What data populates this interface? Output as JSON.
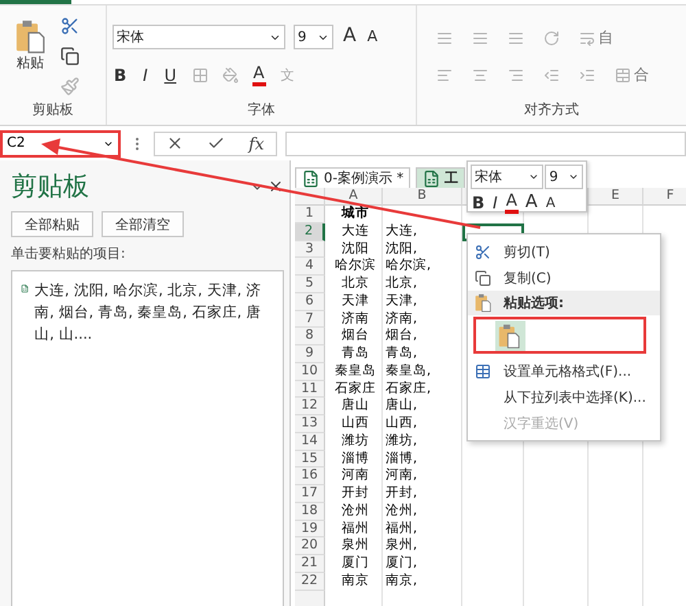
{
  "ribbon": {
    "clipboard": {
      "paste_label": "粘贴",
      "group_label": "剪贴板"
    },
    "font": {
      "name": "宋体",
      "size": "9",
      "grow": "A",
      "shrink": "A",
      "bold": "B",
      "italic": "I",
      "underline": "U",
      "font_color": "A",
      "phonetic": "文",
      "group_label": "字体"
    },
    "alignment": {
      "wrap_label": "自",
      "merge_label": "合",
      "group_label": "对齐方式"
    }
  },
  "formula_bar": {
    "name_box": "C2",
    "highlighted": true,
    "fx": "fx"
  },
  "clipboard_pane": {
    "title": "剪贴板",
    "buttons": [
      "全部粘贴",
      "全部清空"
    ],
    "prompt": "单击要粘贴的项目:",
    "items": [
      {
        "text": "大连, 沈阳, 哈尔滨, 北京, 天津, 济南, 烟台, 青岛, 秦皇岛, 石家庄, 唐山, 山...."
      }
    ]
  },
  "sheet": {
    "tabs": [
      {
        "label": "0-案例演示 *",
        "selected": false
      },
      {
        "label": "工",
        "selected": true
      }
    ],
    "column_headers": [
      "A",
      "B",
      "E",
      "F"
    ],
    "rows": [
      {
        "n": "1",
        "a": "城市",
        "selected": false
      },
      {
        "n": "2",
        "a": "大连",
        "b": "大连,",
        "selected": true
      },
      {
        "n": "3",
        "a": "沈阳",
        "b": "沈阳,",
        "selected": false
      },
      {
        "n": "4",
        "a": "哈尔滨",
        "b": "哈尔滨,",
        "selected": false
      },
      {
        "n": "5",
        "a": "北京",
        "b": "北京,",
        "selected": false
      },
      {
        "n": "6",
        "a": "天津",
        "b": "天津,",
        "selected": false
      },
      {
        "n": "7",
        "a": "济南",
        "b": "济南,",
        "selected": false
      },
      {
        "n": "8",
        "a": "烟台",
        "b": "烟台,",
        "selected": false
      },
      {
        "n": "9",
        "a": "青岛",
        "b": "青岛,",
        "selected": false
      },
      {
        "n": "10",
        "a": "秦皇岛",
        "b": "秦皇岛,",
        "selected": false
      },
      {
        "n": "11",
        "a": "石家庄",
        "b": "石家庄,",
        "selected": false
      },
      {
        "n": "12",
        "a": "唐山",
        "b": "唐山,",
        "selected": false
      },
      {
        "n": "13",
        "a": "山西",
        "b": "山西,",
        "selected": false
      },
      {
        "n": "14",
        "a": "潍坊",
        "b": "潍坊,",
        "selected": false
      },
      {
        "n": "15",
        "a": "淄博",
        "b": "淄博,",
        "selected": false
      },
      {
        "n": "16",
        "a": "河南",
        "b": "河南,",
        "selected": false
      },
      {
        "n": "17",
        "a": "开封",
        "b": "开封,",
        "selected": false
      },
      {
        "n": "18",
        "a": "沧州",
        "b": "沧州,",
        "selected": false
      },
      {
        "n": "19",
        "a": "福州",
        "b": "福州,",
        "selected": false
      },
      {
        "n": "20",
        "a": "泉州",
        "b": "泉州,",
        "selected": false
      },
      {
        "n": "21",
        "a": "厦门",
        "b": "厦门,",
        "selected": false
      },
      {
        "n": "22",
        "a": "南京",
        "b": "南京,",
        "selected": false
      }
    ]
  },
  "mini_toolbar": {
    "font": "宋体",
    "size": "9",
    "bold": "B",
    "italic": "I",
    "font_color": "A",
    "grow": "A",
    "shrink": "A"
  },
  "context_menu": {
    "items": [
      {
        "kind": "item",
        "label": "剪切(T)",
        "disabled": false
      },
      {
        "kind": "item",
        "label": "复制(C)",
        "disabled": false
      },
      {
        "kind": "header",
        "label": "粘贴选项:"
      },
      {
        "kind": "paste-options",
        "highlighted": true
      },
      {
        "kind": "item",
        "label": "设置单元格格式(F)...",
        "disabled": false
      },
      {
        "kind": "item",
        "label": "从下拉列表中选择(K)...",
        "disabled": false
      },
      {
        "kind": "item",
        "label": "汉字重选(V)",
        "disabled": true
      }
    ]
  },
  "annotations": [
    {
      "kind": "arrow"
    }
  ]
}
